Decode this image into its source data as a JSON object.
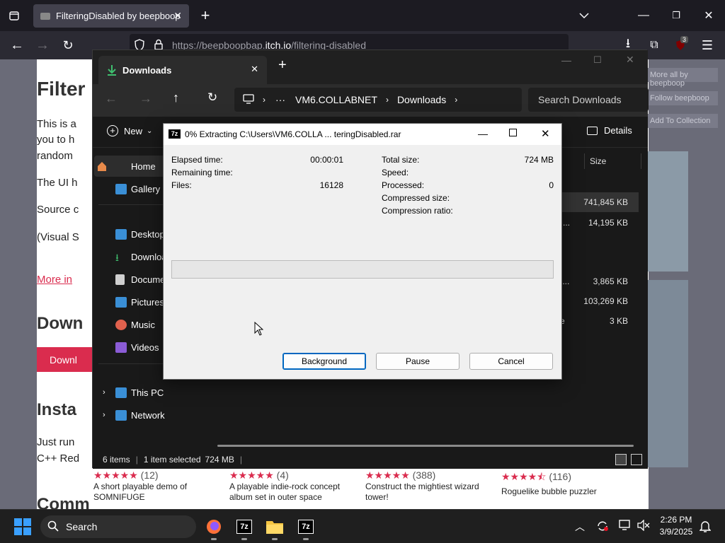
{
  "browser": {
    "tab_title": "FilteringDisabled by beepboop",
    "url_prefix": "https://beepboopbap.",
    "url_domain": "itch.io",
    "url_path": "/filtering-disabled",
    "ext_badge": "3"
  },
  "webpage": {
    "title_partial": "Filter",
    "para1a": "This is a",
    "para1b": "you to h",
    "para1c": "random",
    "para2": "The UI h",
    "para3": "Source c",
    "para4": "(Visual S",
    "more_link": "More in",
    "section_download": "Down",
    "download_btn": "Downl",
    "section_install": "Insta",
    "install_a": "Just run",
    "install_b": "C++ Red",
    "section_comm": "Comm",
    "side_links": [
      "More all by beepboop",
      "Follow beepboop",
      "Add To Collection"
    ],
    "games": [
      {
        "stars": "★★★★★",
        "count": "(12)",
        "desc": "A short playable demo of SOMNIFUGE"
      },
      {
        "stars": "★★★★★",
        "count": "(4)",
        "desc": "A playable indie-rock concept album set in outer space"
      },
      {
        "stars": "★★★★★",
        "count": "(388)",
        "desc": "Construct the mightiest wizard tower!"
      },
      {
        "stars": "★★★★⯪",
        "count": "(116)",
        "desc": "Roguelike bubble puzzler"
      }
    ]
  },
  "explorer": {
    "tab_label": "Downloads",
    "path": [
      "VM6.COLLABNET",
      "Downloads"
    ],
    "search_placeholder": "Search Downloads",
    "new_label": "New",
    "details_label": "Details",
    "column_size": "Size",
    "nav_items": [
      "Home",
      "Gallery",
      "Desktop",
      "Downloa",
      "Docume",
      "Pictures",
      "Music",
      "Videos",
      "This PC",
      "Network"
    ],
    "rows": [
      {
        "name_frag": "",
        "size": "741,845 KB"
      },
      {
        "name_frag": "er ...",
        "size": "14,195 KB"
      },
      {
        "name_frag": "pp...",
        "size": "3,865 KB"
      },
      {
        "name_frag": "",
        "size": "103,269 KB"
      },
      {
        "name_frag": "ate",
        "size": "3 KB"
      }
    ],
    "status_items": "6 items",
    "status_selected": "1 item selected",
    "status_size": "724 MB"
  },
  "dialog": {
    "title": "0% Extracting C:\\Users\\VM6.COLLA ... teringDisabled.rar",
    "elapsed_label": "Elapsed time:",
    "elapsed_value": "00:00:01",
    "remaining_label": "Remaining time:",
    "files_label": "Files:",
    "files_value": "16128",
    "total_label": "Total size:",
    "total_value": "724 MB",
    "speed_label": "Speed:",
    "processed_label": "Processed:",
    "processed_value": "0",
    "compressed_label": "Compressed size:",
    "ratio_label": "Compression ratio:",
    "progress_percent": 0,
    "background_btn": "Background",
    "pause_btn": "Pause",
    "cancel_btn": "Cancel"
  },
  "taskbar": {
    "search_label": "Search",
    "time": "2:26 PM",
    "date": "3/9/2025"
  },
  "colors": {
    "accent_red": "#da2c4e",
    "explorer_bg": "#191919",
    "dialog_bg": "#f0f0f0"
  }
}
